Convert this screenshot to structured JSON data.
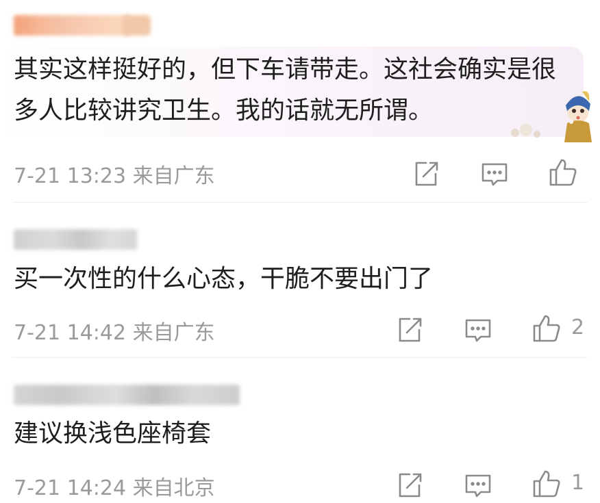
{
  "comments": [
    {
      "text": "其实这样挺好的，但下车请带走。这社会确实是很多人比较讲究卫生。我的话就无所谓。",
      "time": "7-21 13:23",
      "location": "来自广东",
      "like_count": "",
      "has_decor_bubble": true
    },
    {
      "text": "买一次性的什么心态，干脆不要出门了",
      "time": "7-21 14:42",
      "location": "来自广东",
      "like_count": "2"
    },
    {
      "text": "建议换浅色座椅套",
      "time": "7-21 14:24",
      "location": "来自北京",
      "like_count": "1"
    }
  ],
  "icons": {
    "share": "share-icon",
    "reply": "comment-icon",
    "like": "thumbs-up-icon"
  },
  "colors": {
    "meta": "#9a9a9a",
    "text": "#1e1e1e",
    "bubble": "#f6eef6"
  }
}
